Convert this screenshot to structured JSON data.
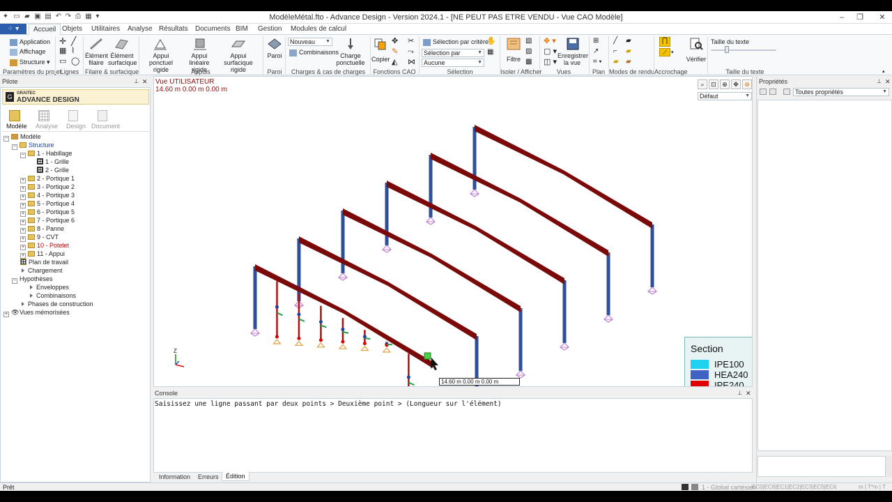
{
  "window": {
    "title": "ModèleMétal.fto - Advance Design - Version 2024.1 - [NE PEUT PAS ETRE VENDU - Vue CAO Modèle]"
  },
  "tabs": [
    "Accueil",
    "Objets",
    "Utilitaires",
    "Analyse",
    "Résultats",
    "Documents",
    "BIM",
    "Gestion",
    "Modules de calcul"
  ],
  "ribbon": {
    "project": {
      "application": "Application",
      "affichage": "Affichage",
      "structure": "Structure",
      "group": "Paramètres du projet"
    },
    "lignes": {
      "group": "Lignes"
    },
    "filaire": {
      "element_filaire": "Élément filaire",
      "element_surfacique": "Élément surfacique",
      "group": "Filaire & surfacique"
    },
    "appuis": {
      "ponctuel": "Appui ponctuel rigide",
      "lineaire": "Appui linéaire rigide",
      "surfacique": "Appui surfacique rigide",
      "group": "Appuis"
    },
    "paroi": {
      "paroi": "Paroi",
      "group": "Paroi"
    },
    "charges": {
      "nouveau": "Nouveau",
      "combinaisons": "Combinaisons",
      "charge_ponctuelle": "Charge ponctuelle",
      "group": "Charges & cas de charges"
    },
    "cao": {
      "copier": "Copier",
      "group": "Fonctions CAO"
    },
    "selection": {
      "par_criteres": "Sélection par critères",
      "selection_par": "Sélection par",
      "aucune": "Aucune",
      "group": "Sélection"
    },
    "isoler": {
      "filtre": "Filtre",
      "group": "Isoler / Afficher"
    },
    "vues": {
      "enregistrer": "Enregistrer la vue",
      "group": "Vues"
    },
    "plan": {
      "group": "Plan"
    },
    "rendu": {
      "group": "Modes de rendu"
    },
    "accrochage": {
      "verifier": "Vérifier",
      "group": "Accrochage"
    },
    "texte": {
      "taille": "Taille du texte",
      "group": "Taille du texte"
    }
  },
  "pilote": {
    "title": "Pilote",
    "brand_small": "GRAITEC",
    "brand": "ADVANCE DESIGN",
    "modes": [
      "Modèle",
      "Analyse",
      "Design",
      "Document"
    ],
    "tree": [
      "Modèle",
      "Structure",
      "1 - Habillage",
      "1 - Grille",
      "2 - Grille",
      "2 - Portique 1",
      "3 - Portique 2",
      "4 - Portique 3",
      "5 - Portique 4",
      "6 - Portique 5",
      "7 - Portique 6",
      "8 - Panne",
      "9 - CVT",
      "10 - Potelet",
      "11 - Appui",
      "Plan de travail",
      "Chargement",
      "Hypothèses",
      "Enveloppes",
      "Combinaisons",
      "Phases de construction",
      "Vues mémorisées"
    ]
  },
  "viewport": {
    "view_name": "Vue UTILISATEUR",
    "coords": "14.60 m  0.00 m  0.00 m",
    "view_combo": "Défaut",
    "cursor_readout": "14.60 m  0.00 m  0.00 m",
    "axis_z": "Z",
    "legend": {
      "title": "Section",
      "items": [
        {
          "name": "IPE100",
          "color": "#20d0f0"
        },
        {
          "name": "HEA240",
          "color": "#3e63c2"
        },
        {
          "name": "IPE240",
          "color": "#e00000"
        }
      ]
    }
  },
  "console": {
    "title": "Console",
    "message": "Saisissez une ligne passant par deux points > Deuxième point > (Longueur sur l'élément)",
    "tabs": [
      "Information",
      "Erreurs",
      "Édition"
    ]
  },
  "properties": {
    "title": "Propriétés",
    "combo": "Toutes propriétés"
  },
  "status": {
    "left": "Prêt",
    "coord_system": "1 - Global cartésien",
    "codes": "EC0|EC8|EC1|EC2|EC3|EC5|EC6",
    "units": "m  |  T*m  |  T"
  },
  "colors": {
    "beam": "#7a0a0a",
    "column": "#2e4f9a",
    "potelet": "#b01010",
    "support": "#c080d0"
  }
}
